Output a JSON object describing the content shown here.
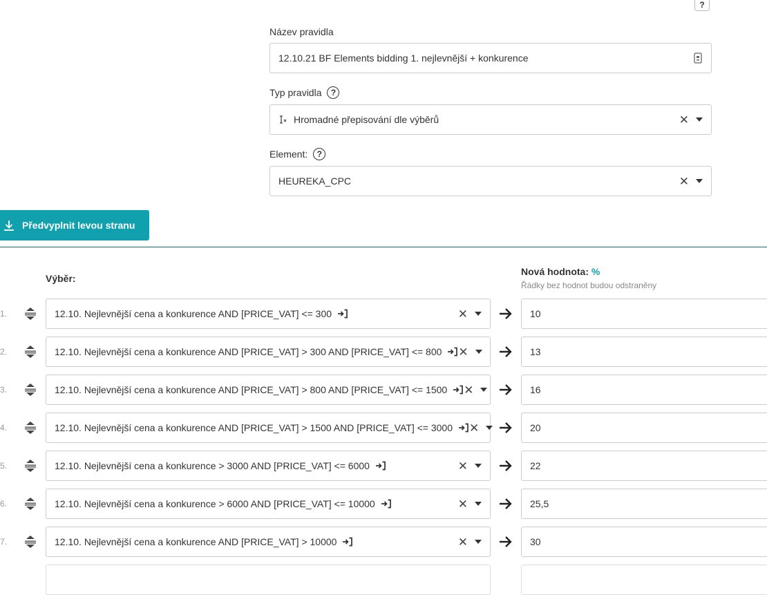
{
  "header": {
    "help_label": "?"
  },
  "form": {
    "rule_name": {
      "label": "Název pravidla",
      "value": "12.10.21 BF Elements bidding 1. nejlevnější + konkurence",
      "icon": "password-manager-icon"
    },
    "rule_type": {
      "label": "Typ pravidla",
      "value": "Hromadné přepisování dle výběrů",
      "prefix_icon": "text-cursor-clear-icon"
    },
    "element": {
      "label": "Element:",
      "value": "HEUREKA_CPC"
    }
  },
  "actions": {
    "prefill_label": "Předvyplnit levou stranu"
  },
  "mapping": {
    "selection_header": "Výběr:",
    "value_header": "Nová hodnota:",
    "value_unit": "%",
    "value_note": "Řádky bez hodnot budou odstraněny",
    "rows": [
      {
        "num": "1.",
        "selection": "12.10. Nejlevnější cena a konkurence AND [PRICE_VAT] <= 300",
        "value": "10"
      },
      {
        "num": "2.",
        "selection": "12.10. Nejlevnější cena a konkurence AND [PRICE_VAT] > 300 AND [PRICE_VAT] <= 800",
        "value": "13"
      },
      {
        "num": "3.",
        "selection": "12.10. Nejlevnější cena a konkurence AND [PRICE_VAT] > 800 AND [PRICE_VAT] <= 1500",
        "value": "16"
      },
      {
        "num": "4.",
        "selection": "12.10. Nejlevnější cena a konkurence AND [PRICE_VAT] > 1500 AND [PRICE_VAT] <= 3000",
        "value": "20"
      },
      {
        "num": "5.",
        "selection": "12.10. Nejlevnější cena a konkurence > 3000 AND [PRICE_VAT] <= 6000",
        "value": "22"
      },
      {
        "num": "6.",
        "selection": "12.10. Nejlevnější cena a konkurence > 6000 AND [PRICE_VAT] <= 10000",
        "value": "25,5"
      },
      {
        "num": "7.",
        "selection": "12.10. Nejlevnější cena a konkurence AND [PRICE_VAT] > 10000",
        "value": "30"
      }
    ]
  },
  "colors": {
    "accent": "#11a0ad",
    "divider": "#1b6b70"
  }
}
